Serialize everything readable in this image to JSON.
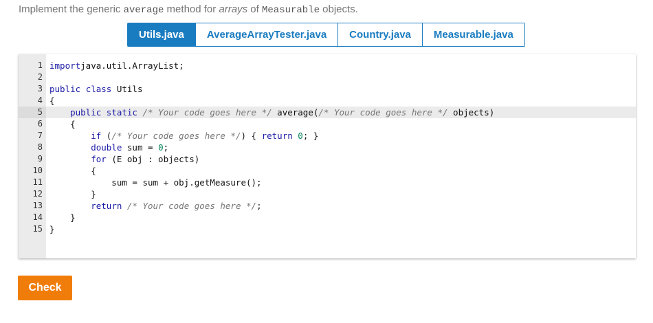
{
  "instruction": {
    "part1": "Implement the generic ",
    "code1": "average",
    "part2": " method for ",
    "emph": "arrays",
    "part3": " of ",
    "code2": "Measurable",
    "part4": " objects."
  },
  "tabs": [
    {
      "label": "Utils.java",
      "active": true
    },
    {
      "label": "AverageArrayTester.java",
      "active": false
    },
    {
      "label": "Country.java",
      "active": false
    },
    {
      "label": "Measurable.java",
      "active": false
    }
  ],
  "editor": {
    "highlighted_line": 5,
    "lines": [
      {
        "n": "1",
        "tokens": [
          [
            "kw",
            "import"
          ],
          [
            "",
            "java.util.ArrayList;"
          ]
        ]
      },
      {
        "n": "2",
        "tokens": []
      },
      {
        "n": "3",
        "tokens": [
          [
            "kw",
            "public"
          ],
          [
            "",
            " "
          ],
          [
            "kw",
            "class"
          ],
          [
            "",
            " Utils"
          ]
        ]
      },
      {
        "n": "4",
        "tokens": [
          [
            "",
            "{"
          ]
        ]
      },
      {
        "n": "5",
        "tokens": [
          [
            "",
            "    "
          ],
          [
            "kw",
            "public"
          ],
          [
            "",
            " "
          ],
          [
            "kw",
            "static"
          ],
          [
            "",
            " "
          ],
          [
            "cm",
            "/* Your code goes here */"
          ],
          [
            "",
            " average("
          ],
          [
            "cm",
            "/* Your code goes here */"
          ],
          [
            "",
            " objects)"
          ]
        ]
      },
      {
        "n": "6",
        "tokens": [
          [
            "",
            "    {"
          ]
        ]
      },
      {
        "n": "7",
        "tokens": [
          [
            "",
            "        "
          ],
          [
            "kw",
            "if"
          ],
          [
            "",
            " ("
          ],
          [
            "cm",
            "/* Your code goes here */"
          ],
          [
            "",
            ") { "
          ],
          [
            "kw",
            "return"
          ],
          [
            "",
            " "
          ],
          [
            "num",
            "0"
          ],
          [
            "",
            "; }"
          ]
        ]
      },
      {
        "n": "8",
        "tokens": [
          [
            "",
            "        "
          ],
          [
            "kw",
            "double"
          ],
          [
            "",
            " sum = "
          ],
          [
            "num",
            "0"
          ],
          [
            "",
            ";"
          ]
        ]
      },
      {
        "n": "9",
        "tokens": [
          [
            "",
            "        "
          ],
          [
            "kw",
            "for"
          ],
          [
            "",
            " (E obj : objects)"
          ]
        ]
      },
      {
        "n": "10",
        "tokens": [
          [
            "",
            "        {"
          ]
        ]
      },
      {
        "n": "11",
        "tokens": [
          [
            "",
            "            sum = sum + obj.getMeasure();"
          ]
        ]
      },
      {
        "n": "12",
        "tokens": [
          [
            "",
            "        }"
          ]
        ]
      },
      {
        "n": "13",
        "tokens": [
          [
            "",
            "        "
          ],
          [
            "kw",
            "return"
          ],
          [
            "",
            " "
          ],
          [
            "cm",
            "/* Your code goes here */"
          ],
          [
            "",
            ";"
          ]
        ]
      },
      {
        "n": "14",
        "tokens": [
          [
            "",
            "    }"
          ]
        ]
      },
      {
        "n": "15",
        "tokens": [
          [
            "",
            "}"
          ]
        ]
      }
    ]
  },
  "check_label": "Check"
}
